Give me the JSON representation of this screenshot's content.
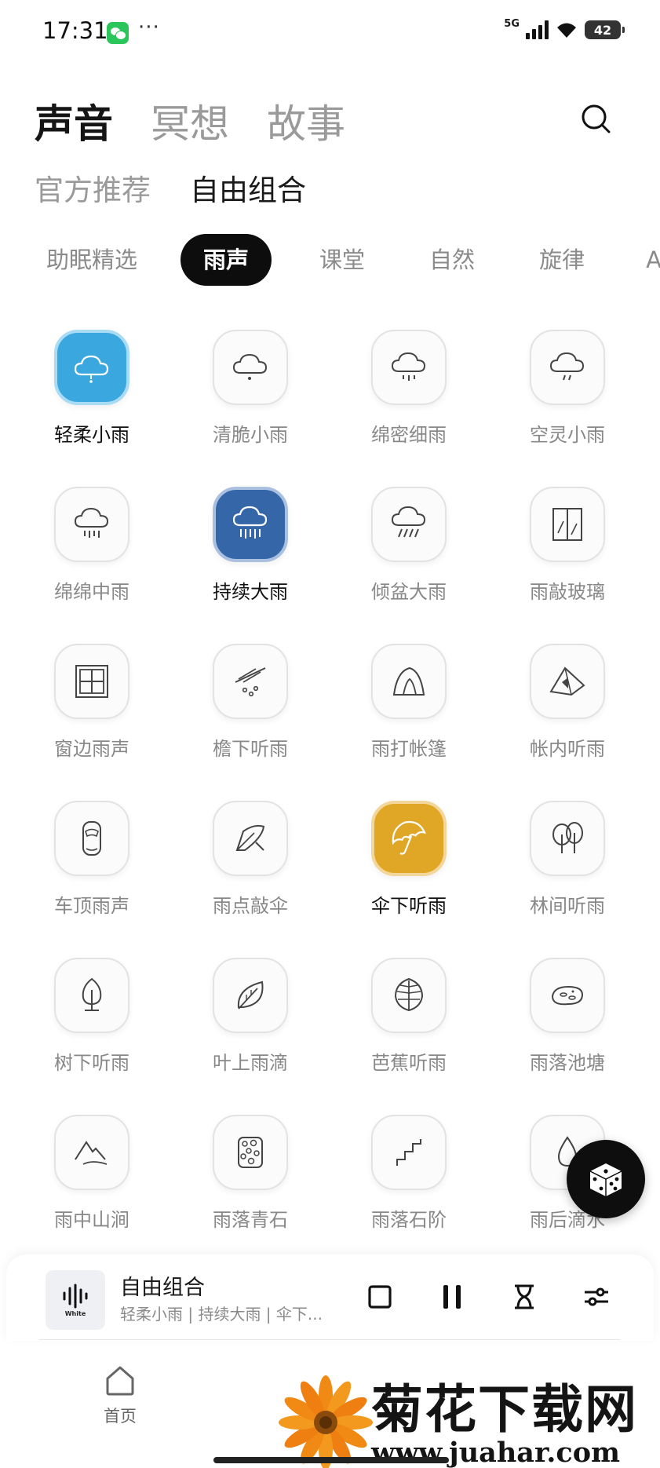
{
  "status_bar": {
    "time": "17:31",
    "dots": "···",
    "network": "5G",
    "battery": "42"
  },
  "main_tabs": [
    {
      "label": "声音",
      "active": true
    },
    {
      "label": "冥想",
      "active": false
    },
    {
      "label": "故事",
      "active": false
    }
  ],
  "sub_tabs": [
    {
      "label": "官方推荐",
      "active": false
    },
    {
      "label": "自由组合",
      "active": true
    }
  ],
  "categories": [
    {
      "label": "助眠精选",
      "active": false
    },
    {
      "label": "雨声",
      "active": true
    },
    {
      "label": "课堂",
      "active": false
    },
    {
      "label": "自然",
      "active": false
    },
    {
      "label": "旋律",
      "active": false
    },
    {
      "label": "A",
      "active": false
    }
  ],
  "sounds": [
    {
      "label": "轻柔小雨",
      "icon": "cloud-light-rain-icon",
      "selected": true,
      "color": "#3aa8df"
    },
    {
      "label": "清脆小雨",
      "icon": "cloud-drop-icon",
      "selected": false
    },
    {
      "label": "绵密细雨",
      "icon": "cloud-drizzle-icon",
      "selected": false
    },
    {
      "label": "空灵小雨",
      "icon": "cloud-slant-rain-icon",
      "selected": false
    },
    {
      "label": "绵绵中雨",
      "icon": "cloud-rain-icon",
      "selected": false
    },
    {
      "label": "持续大雨",
      "icon": "cloud-heavy-rain-icon",
      "selected": true,
      "color": "#3466a8"
    },
    {
      "label": "倾盆大雨",
      "icon": "cloud-downpour-icon",
      "selected": false
    },
    {
      "label": "雨敲玻璃",
      "icon": "glass-window-icon",
      "selected": false
    },
    {
      "label": "窗边雨声",
      "icon": "window-icon",
      "selected": false
    },
    {
      "label": "檐下听雨",
      "icon": "eaves-icon",
      "selected": false
    },
    {
      "label": "雨打帐篷",
      "icon": "tent-icon",
      "selected": false
    },
    {
      "label": "帐内听雨",
      "icon": "tent-inside-icon",
      "selected": false
    },
    {
      "label": "车顶雨声",
      "icon": "car-icon",
      "selected": false
    },
    {
      "label": "雨点敲伞",
      "icon": "umbrella-closed-icon",
      "selected": false
    },
    {
      "label": "伞下听雨",
      "icon": "umbrella-icon",
      "selected": true,
      "color": "#e0a626"
    },
    {
      "label": "林间听雨",
      "icon": "trees-icon",
      "selected": false
    },
    {
      "label": "树下听雨",
      "icon": "tree-icon",
      "selected": false
    },
    {
      "label": "叶上雨滴",
      "icon": "leaf-icon",
      "selected": false
    },
    {
      "label": "芭蕉听雨",
      "icon": "banana-leaf-icon",
      "selected": false
    },
    {
      "label": "雨落池塘",
      "icon": "pond-icon",
      "selected": false
    },
    {
      "label": "雨中山涧",
      "icon": "mountain-stream-icon",
      "selected": false
    },
    {
      "label": "雨落青石",
      "icon": "stones-icon",
      "selected": false
    },
    {
      "label": "雨落石阶",
      "icon": "stairs-icon",
      "selected": false
    },
    {
      "label": "雨后滴水",
      "icon": "water-drop-icon",
      "selected": false
    }
  ],
  "player": {
    "cover_label": "White",
    "title": "自由组合",
    "subtitle": "轻柔小雨 | 持续大雨 | 伞下...",
    "controls": [
      "stop-icon",
      "pause-icon",
      "hourglass-timer-icon",
      "sliders-icon"
    ]
  },
  "bottom_nav": {
    "home_label": "首页"
  },
  "watermark": {
    "title": "菊花下载网",
    "url": "www.juahar.com"
  }
}
